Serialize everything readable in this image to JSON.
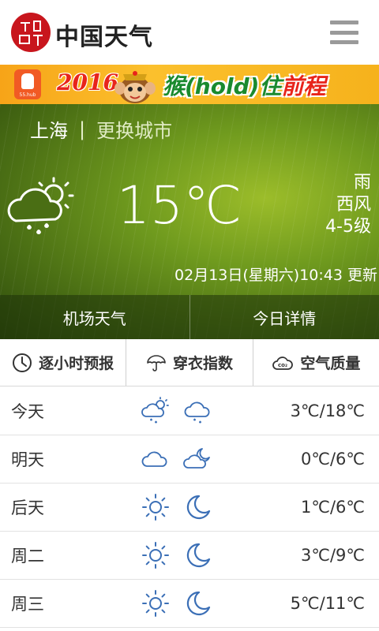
{
  "header": {
    "brand": "中国天气",
    "logo_text": "中国天气"
  },
  "banner": {
    "year": "2016",
    "slogan_green": "猴(hold)住",
    "slogan_red": "前程",
    "app_label": "55.hub"
  },
  "current": {
    "city": "上海",
    "separator": "|",
    "change_city": "更换城市",
    "temperature": "15℃",
    "condition": "雨",
    "wind_direction": "西风",
    "wind_level": "4-5级",
    "updated": "02月13日(星期六)10:43 更新",
    "icon": "cloud-sun-rain-icon"
  },
  "hero_tabs": [
    {
      "label": "机场天气"
    },
    {
      "label": "今日详情"
    }
  ],
  "index_tabs": [
    {
      "label": "逐小时预报",
      "icon": "clock-icon"
    },
    {
      "label": "穿衣指数",
      "icon": "umbrella-icon"
    },
    {
      "label": "空气质量",
      "icon": "co2-cloud-icon"
    }
  ],
  "forecast": [
    {
      "day": "今天",
      "temp": "3℃/18℃",
      "day_icon": "cloud-sun-rain-icon",
      "night_icon": "cloud-rain-icon"
    },
    {
      "day": "明天",
      "temp": "0℃/6℃",
      "day_icon": "cloud-icon",
      "night_icon": "cloud-moon-icon"
    },
    {
      "day": "后天",
      "temp": "1℃/6℃",
      "day_icon": "sun-icon",
      "night_icon": "moon-icon"
    },
    {
      "day": "周二",
      "temp": "3℃/9℃",
      "day_icon": "sun-icon",
      "night_icon": "moon-icon"
    },
    {
      "day": "周三",
      "temp": "5℃/11℃",
      "day_icon": "sun-icon",
      "night_icon": "moon-icon"
    }
  ],
  "colors": {
    "icon_blue": "#3b6fb6",
    "banner_orange": "#f7a418",
    "hero_green": "#6f9a1e",
    "logo_red": "#c8161d"
  }
}
